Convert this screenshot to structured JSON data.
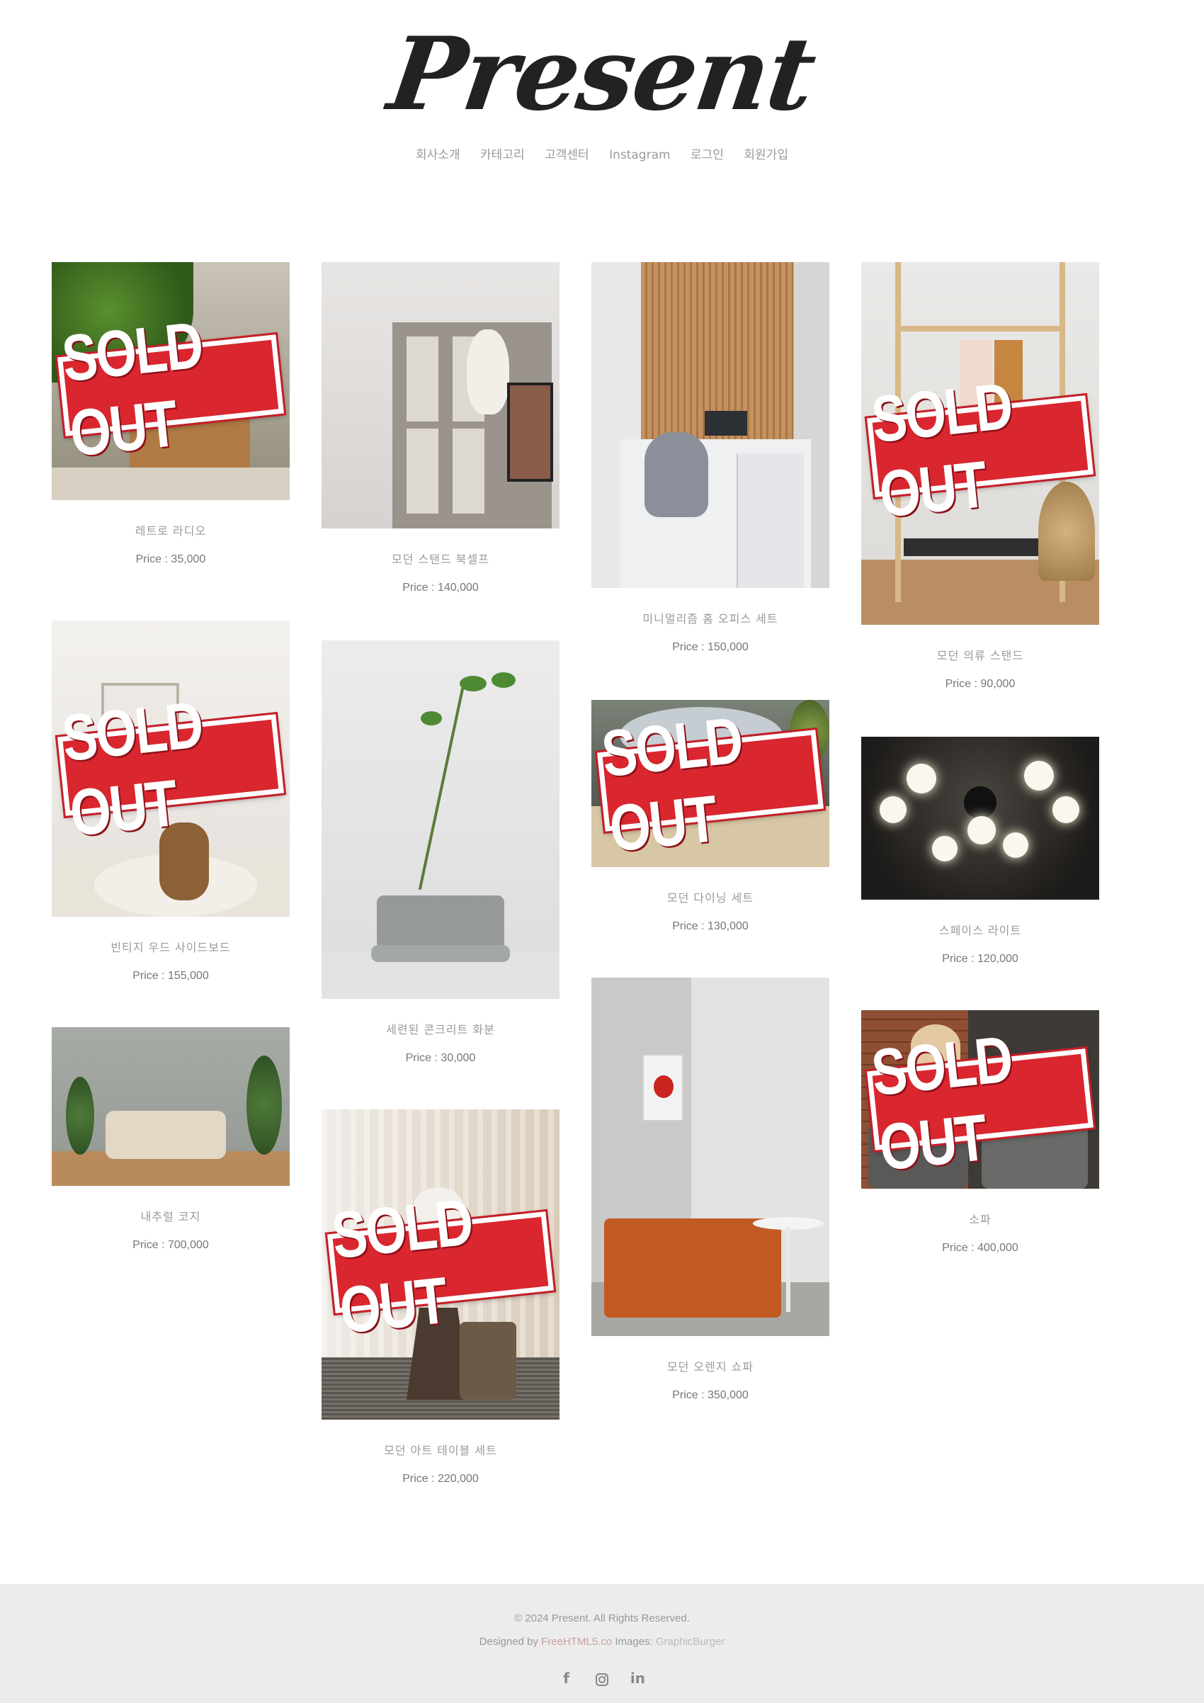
{
  "brand": {
    "logo": "Present"
  },
  "nav": [
    "회사소개",
    "카테고리",
    "고객센터",
    "Instagram",
    "로그인",
    "회원가입"
  ],
  "products": [
    {
      "name": "레트로 라디오",
      "price": "Price : 35,000",
      "sold_out": true
    },
    {
      "name": "모던 스탠드 북셀프",
      "price": "Price : 140,000",
      "sold_out": false
    },
    {
      "name": "미니멀리즘 홈 오피스 세트",
      "price": "Price : 150,000",
      "sold_out": false
    },
    {
      "name": "모던 의류 스탠드",
      "price": "Price : 90,000",
      "sold_out": true
    },
    {
      "name": "빈티지 우드 사이드보드",
      "price": "Price : 155,000",
      "sold_out": true
    },
    {
      "name": "세련된 콘크리트 화분",
      "price": "Price : 30,000",
      "sold_out": false
    },
    {
      "name": "모던 다이닝 세트",
      "price": "Price : 130,000",
      "sold_out": true
    },
    {
      "name": "스페이스 라이트",
      "price": "Price : 120,000",
      "sold_out": false
    },
    {
      "name": "내추럴 코지",
      "price": "Price : 700,000",
      "sold_out": false
    },
    {
      "name": "모던 아트 테이블 세트",
      "price": "Price : 220,000",
      "sold_out": true
    },
    {
      "name": "모던 오렌지 쇼파",
      "price": "Price : 350,000",
      "sold_out": false
    },
    {
      "name": "소파",
      "price": "Price : 400,000",
      "sold_out": true
    }
  ],
  "stamp_text": "SOLD OUT",
  "footer": {
    "copyright": "© 2024 Present. All Rights Reserved.",
    "designed_by": "Designed by",
    "designer_link": "FreeHTML5.co",
    "images_label": "Images:",
    "images_link": "GraphicBurger",
    "social_icons": [
      "facebook-icon",
      "instagram-icon",
      "linkedin-icon"
    ]
  },
  "colors": {
    "stamp_red": "#d9262f",
    "footer_bg": "#ececec",
    "text_muted": "#999999"
  }
}
